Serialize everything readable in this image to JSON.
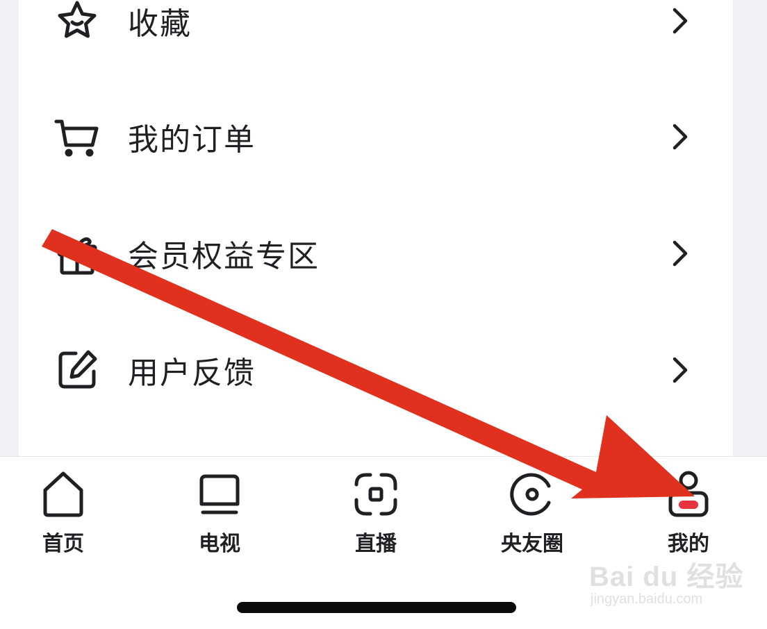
{
  "menu": {
    "items": [
      {
        "label": "收藏",
        "icon": "star-icon"
      },
      {
        "label": "我的订单",
        "icon": "cart-icon"
      },
      {
        "label": "会员权益专区",
        "icon": "gift-icon"
      },
      {
        "label": "用户反馈",
        "icon": "edit-icon"
      }
    ]
  },
  "tabbar": {
    "tabs": [
      {
        "label": "首页",
        "icon": "home-icon"
      },
      {
        "label": "电视",
        "icon": "tv-icon"
      },
      {
        "label": "直播",
        "icon": "live-icon"
      },
      {
        "label": "央友圈",
        "icon": "circle-icon"
      },
      {
        "label": "我的",
        "icon": "profile-icon",
        "active": true
      }
    ]
  },
  "watermark": {
    "logo": "Bai du 经验",
    "url": "jingyan.baidu.com"
  },
  "colors": {
    "text": "#1f1f24",
    "accent_red": "#e8333f",
    "arrow_red": "#e0301e",
    "background": "#f0f1f5"
  }
}
